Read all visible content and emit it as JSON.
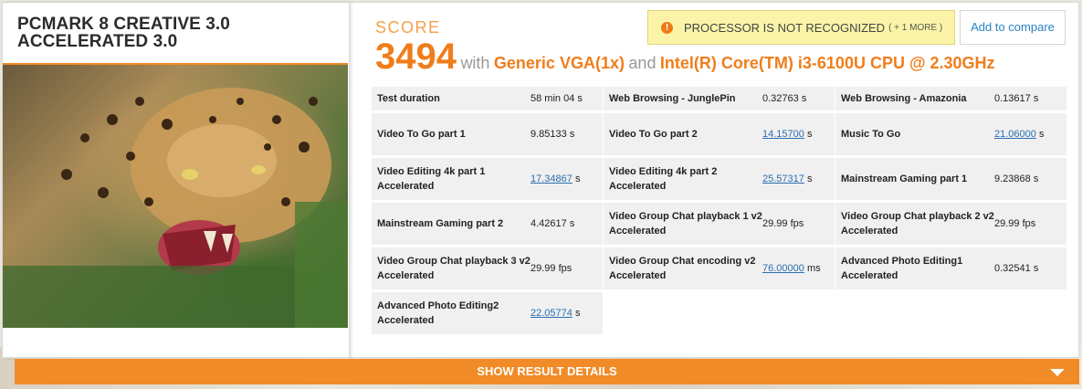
{
  "benchmark": {
    "title": "PCMARK 8 CREATIVE 3.0 ACCELERATED 3.0"
  },
  "score": {
    "label": "SCORE",
    "value": "3494",
    "with_text": "with",
    "gpu": "Generic VGA(1x)",
    "and_text": "and",
    "cpu": "Intel(R) Core(TM) i3-6100U CPU @ 2.30GHz"
  },
  "warning": {
    "text": "PROCESSOR IS NOT RECOGNIZED",
    "more": "( + 1 MORE )",
    "icon": "alert-icon",
    "icon_glyph": "!"
  },
  "compare_label": "Add to compare",
  "results": [
    {
      "name": "Test duration",
      "value": "58 min 04 s",
      "link": false
    },
    {
      "name": "Web Browsing - JunglePin",
      "value": "0.32763 s",
      "link": false
    },
    {
      "name": "Web Browsing - Amazonia",
      "value": "0.13617 s",
      "link": false
    },
    {
      "name": "Video To Go part 1",
      "value": "9.85133 s",
      "link": false
    },
    {
      "name": "Video To Go part 2",
      "value": "14.15700",
      "unit": " s",
      "link": true
    },
    {
      "name": "Music To Go",
      "value": "21.06000",
      "unit": " s",
      "link": true
    },
    {
      "name": "Video Editing 4k part 1 Accelerated",
      "value": "17.34867",
      "unit": " s",
      "link": true
    },
    {
      "name": "Video Editing 4k part 2 Accelerated",
      "value": "25.57317",
      "unit": " s",
      "link": true
    },
    {
      "name": "Mainstream Gaming part 1",
      "value": "9.23868 s",
      "link": false
    },
    {
      "name": "Mainstream Gaming part 2",
      "value": "4.42617 s",
      "link": false
    },
    {
      "name": "Video Group Chat playback 1 v2 Accelerated",
      "value": "29.99 fps",
      "link": false
    },
    {
      "name": "Video Group Chat playback 2 v2 Accelerated",
      "value": "29.99 fps",
      "link": false
    },
    {
      "name": "Video Group Chat playback 3 v2 Accelerated",
      "value": "29.99 fps",
      "link": false
    },
    {
      "name": "Video Group Chat encoding v2 Accelerated",
      "value": "76.00000",
      "unit": " ms",
      "link": true
    },
    {
      "name": "Advanced Photo Editing1 Accelerated",
      "value": "0.32541 s",
      "link": false
    },
    {
      "name": "Advanced Photo Editing2 Accelerated",
      "value": "22.05774",
      "unit": " s",
      "link": true
    }
  ],
  "details_button": "SHOW RESULT DETAILS",
  "colors": {
    "accent": "#f07d1a",
    "bar": "#f18b27",
    "warning_bg": "#fbf4a8",
    "link": "#2a6fb0"
  }
}
